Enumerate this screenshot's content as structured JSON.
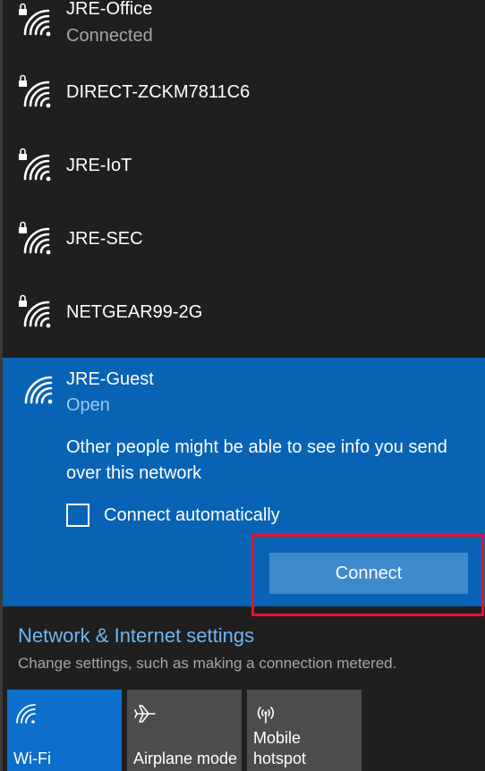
{
  "networks": [
    {
      "name": "JRE-Office",
      "status": "Connected",
      "icon": "wifi-secured-icon"
    },
    {
      "name": "DIRECT-ZCKM7811C6",
      "icon": "wifi-secured-icon"
    },
    {
      "name": "JRE-IoT",
      "icon": "wifi-secured-icon"
    },
    {
      "name": "JRE-SEC",
      "icon": "wifi-secured-icon"
    },
    {
      "name": "NETGEAR99-2G",
      "icon": "wifi-secured-icon"
    }
  ],
  "selected_network": {
    "name": "JRE-Guest",
    "status": "Open",
    "warning": "Other people might be able to see info you send over this network",
    "connect_automatically_label": "Connect automatically",
    "connect_automatically_checked": false,
    "connect_button_label": "Connect",
    "icon": "wifi-open-icon"
  },
  "settings": {
    "link_label": "Network & Internet settings",
    "description": "Change settings, such as making a connection metered."
  },
  "quick_actions": [
    {
      "label": "Wi-Fi",
      "active": true,
      "icon": "wifi-icon"
    },
    {
      "label": "Airplane mode",
      "active": false,
      "icon": "airplane-icon"
    },
    {
      "label": "Mobile\nhotspot",
      "active": false,
      "icon": "hotspot-icon"
    }
  ],
  "colors": {
    "background": "#1f1f1f",
    "selected_panel": "#0863b4",
    "connect_button": "#3f89cd",
    "highlight_border": "#e8112d",
    "settings_link": "#6cb6f5",
    "active_tile": "#0b6fcb",
    "inactive_tile": "#4c4c4c"
  }
}
